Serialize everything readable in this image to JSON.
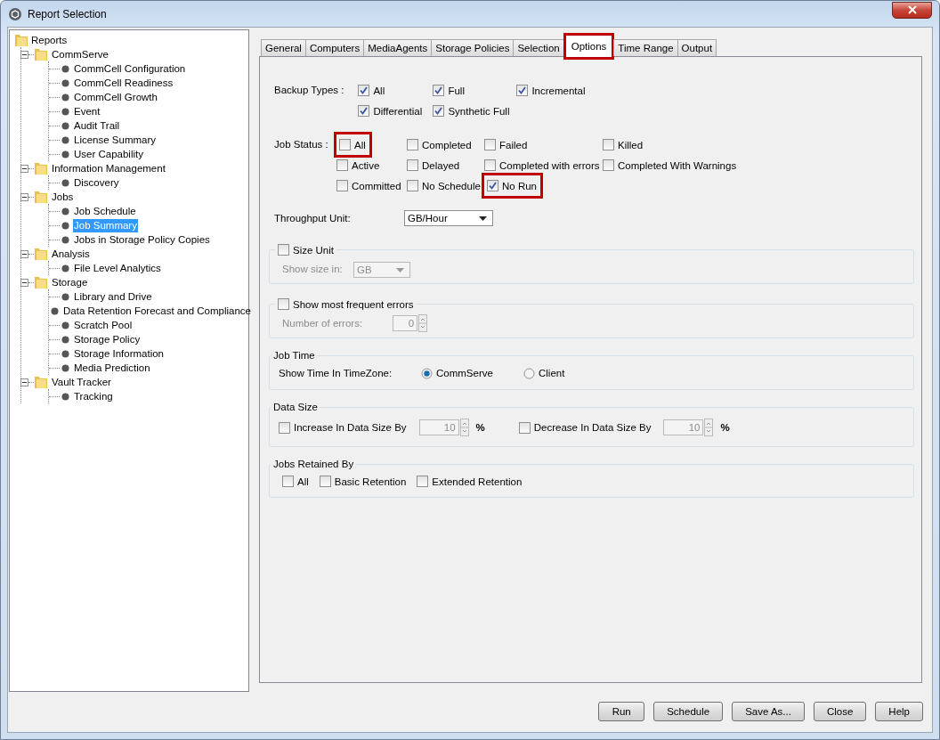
{
  "window": {
    "title": "Report Selection"
  },
  "tree": {
    "label": "Reports",
    "children": [
      {
        "label": "CommServe",
        "expanded": true,
        "children": [
          {
            "label": "CommCell Configuration",
            "selected": false
          },
          {
            "label": "CommCell Readiness",
            "selected": false
          },
          {
            "label": "CommCell Growth",
            "selected": false
          },
          {
            "label": "Event",
            "selected": false
          },
          {
            "label": "Audit Trail",
            "selected": false
          },
          {
            "label": "License Summary",
            "selected": false
          },
          {
            "label": "User Capability",
            "selected": false
          }
        ]
      },
      {
        "label": "Information Management",
        "expanded": true,
        "children": [
          {
            "label": "Discovery",
            "selected": false
          }
        ]
      },
      {
        "label": "Jobs",
        "expanded": true,
        "children": [
          {
            "label": "Job Schedule",
            "selected": false
          },
          {
            "label": "Job Summary",
            "selected": true
          },
          {
            "label": "Jobs in Storage Policy Copies",
            "selected": false
          }
        ]
      },
      {
        "label": "Analysis",
        "expanded": true,
        "children": [
          {
            "label": "File Level Analytics",
            "selected": false
          }
        ]
      },
      {
        "label": "Storage",
        "expanded": true,
        "children": [
          {
            "label": "Library and Drive",
            "selected": false
          },
          {
            "label": "Data Retention Forecast and Compliance",
            "selected": false
          },
          {
            "label": "Scratch Pool",
            "selected": false
          },
          {
            "label": "Storage Policy",
            "selected": false
          },
          {
            "label": "Storage Information",
            "selected": false
          },
          {
            "label": "Media Prediction",
            "selected": false
          }
        ]
      },
      {
        "label": "Vault Tracker",
        "expanded": true,
        "children": [
          {
            "label": "Tracking",
            "selected": false
          }
        ]
      }
    ]
  },
  "tabs": [
    {
      "label": "General",
      "selected": false,
      "highlighted": false
    },
    {
      "label": "Computers",
      "selected": false,
      "highlighted": false
    },
    {
      "label": "MediaAgents",
      "selected": false,
      "highlighted": false
    },
    {
      "label": "Storage Policies",
      "selected": false,
      "highlighted": false
    },
    {
      "label": "Selection",
      "selected": false,
      "highlighted": false
    },
    {
      "label": "Options",
      "selected": true,
      "highlighted": true
    },
    {
      "label": "Time Range",
      "selected": false,
      "highlighted": false
    },
    {
      "label": "Output",
      "selected": false,
      "highlighted": false
    }
  ],
  "backup_types": {
    "label": "Backup Types :",
    "items": [
      {
        "label": "All",
        "checked": true,
        "highlighted": false
      },
      {
        "label": "Full",
        "checked": true,
        "highlighted": false
      },
      {
        "label": "Incremental",
        "checked": true,
        "highlighted": false
      },
      {
        "label": "Differential",
        "checked": true,
        "highlighted": false
      },
      {
        "label": "Synthetic Full",
        "checked": true,
        "highlighted": false
      }
    ]
  },
  "job_status": {
    "label": "Job Status :",
    "items": [
      {
        "label": "All",
        "checked": false,
        "highlighted": true
      },
      {
        "label": "Completed",
        "checked": false,
        "highlighted": false
      },
      {
        "label": "Failed",
        "checked": false,
        "highlighted": false
      },
      {
        "label": "Killed",
        "checked": false,
        "highlighted": false
      },
      {
        "label": "Active",
        "checked": false,
        "highlighted": false
      },
      {
        "label": "Delayed",
        "checked": false,
        "highlighted": false
      },
      {
        "label": "Completed with errors",
        "checked": false,
        "highlighted": false
      },
      {
        "label": "Completed With Warnings",
        "checked": false,
        "highlighted": false
      },
      {
        "label": "Committed",
        "checked": false,
        "highlighted": false
      },
      {
        "label": "No Schedule",
        "checked": false,
        "highlighted": false
      },
      {
        "label": "No Run",
        "checked": true,
        "highlighted": true
      }
    ]
  },
  "throughput_unit": {
    "label": "Throughput Unit:",
    "value": "GB/Hour"
  },
  "size_unit": {
    "label": "Size Unit",
    "checked": false,
    "field_label": "Show size in:",
    "value": "GB",
    "disabled": true
  },
  "frequent_errors": {
    "label": "Show most frequent errors",
    "checked": false,
    "field_label": "Number of errors:",
    "value": "0",
    "disabled": true
  },
  "job_time": {
    "title": "Job Time",
    "label": "Show Time In TimeZone:",
    "options": [
      {
        "label": "CommServe",
        "selected": true
      },
      {
        "label": "Client",
        "selected": false
      }
    ]
  },
  "data_size": {
    "title": "Data Size",
    "items": [
      {
        "label": "Increase In Data Size By",
        "checked": false,
        "value": "10",
        "unit": "%",
        "disabled": true
      },
      {
        "label": "Decrease In Data Size By",
        "checked": false,
        "value": "10",
        "unit": "%",
        "disabled": true
      }
    ]
  },
  "jobs_retained": {
    "title": "Jobs Retained By",
    "items": [
      {
        "label": "All",
        "checked": false
      },
      {
        "label": "Basic Retention",
        "checked": false
      },
      {
        "label": "Extended Retention",
        "checked": false
      }
    ]
  },
  "buttons": [
    "Run",
    "Schedule",
    "Save As...",
    "Close",
    "Help"
  ]
}
